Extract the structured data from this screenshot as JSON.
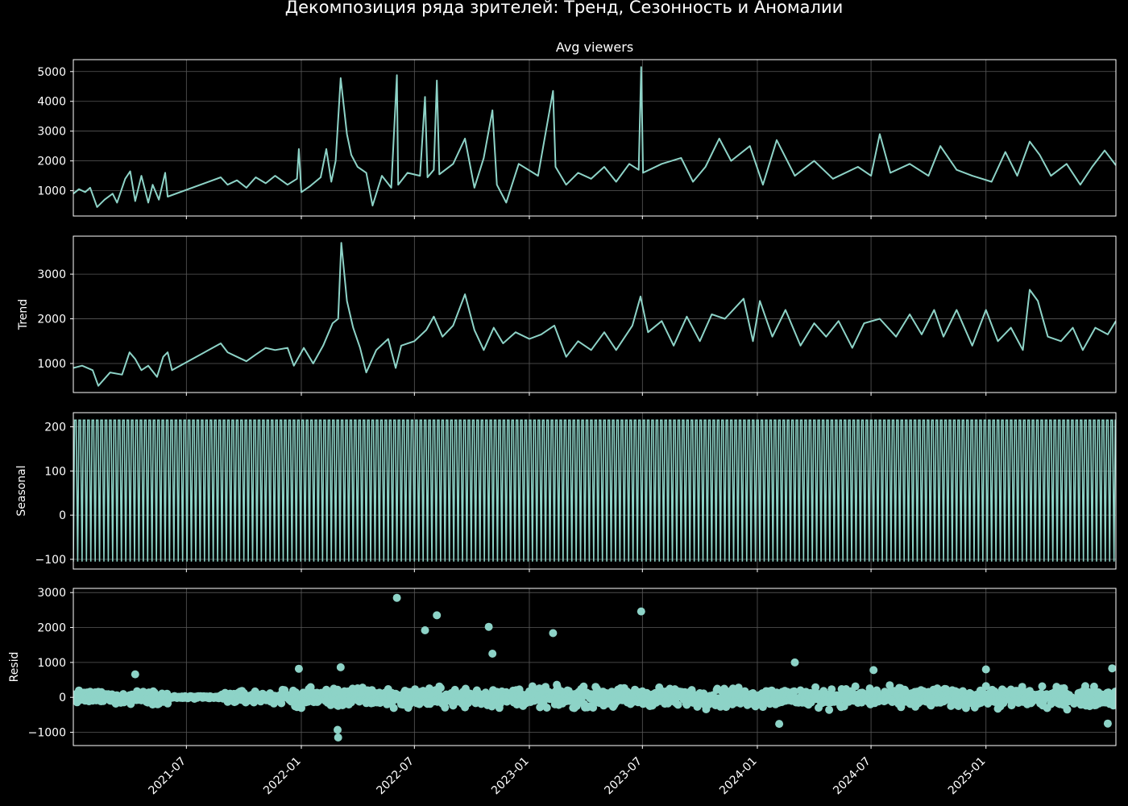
{
  "figure": {
    "title": "Декомпозиция ряда зрителей: Тренд, Сезонность и Аномалии",
    "line_color": "#8dd3c7",
    "background": "#000000"
  },
  "x_axis": {
    "type": "date",
    "range": [
      "2021-01-01",
      "2025-07-28"
    ],
    "tick_values": [
      "2021-07-01",
      "2022-01-01",
      "2022-07-01",
      "2023-01-01",
      "2023-07-01",
      "2024-01-01",
      "2024-07-01",
      "2025-01-01"
    ],
    "tick_labels": [
      "2021-07",
      "2022-01",
      "2022-07",
      "2023-01",
      "2023-07",
      "2024-01",
      "2024-07",
      "2025-01"
    ]
  },
  "chart_data": [
    {
      "type": "line",
      "title": "Avg viewers",
      "ylabel": "",
      "ylim": [
        150,
        5400
      ],
      "yticks": [
        1000,
        2000,
        3000,
        4000,
        5000
      ],
      "grid": true,
      "points": [
        [
          "2021-01-01",
          900
        ],
        [
          "2021-01-10",
          1050
        ],
        [
          "2021-01-20",
          950
        ],
        [
          "2021-01-28",
          1100
        ],
        [
          "2021-02-08",
          450
        ],
        [
          "2021-02-20",
          700
        ],
        [
          "2021-03-05",
          900
        ],
        [
          "2021-03-12",
          600
        ],
        [
          "2021-03-25",
          1400
        ],
        [
          "2021-04-02",
          1650
        ],
        [
          "2021-04-10",
          650
        ],
        [
          "2021-04-20",
          1500
        ],
        [
          "2021-05-01",
          600
        ],
        [
          "2021-05-08",
          1200
        ],
        [
          "2021-05-18",
          700
        ],
        [
          "2021-05-28",
          1600
        ],
        [
          "2021-06-01",
          800
        ],
        [
          "2021-08-25",
          1450
        ],
        [
          "2021-09-05",
          1200
        ],
        [
          "2021-09-20",
          1350
        ],
        [
          "2021-10-05",
          1100
        ],
        [
          "2021-10-20",
          1450
        ],
        [
          "2021-11-05",
          1250
        ],
        [
          "2021-11-20",
          1500
        ],
        [
          "2021-12-10",
          1200
        ],
        [
          "2021-12-25",
          1400
        ],
        [
          "2021-12-28",
          2400
        ],
        [
          "2022-01-01",
          950
        ],
        [
          "2022-01-15",
          1150
        ],
        [
          "2022-02-01",
          1450
        ],
        [
          "2022-02-10",
          2400
        ],
        [
          "2022-02-18",
          1300
        ],
        [
          "2022-02-25",
          2000
        ],
        [
          "2022-03-05",
          4780
        ],
        [
          "2022-03-08",
          4200
        ],
        [
          "2022-03-15",
          2900
        ],
        [
          "2022-03-22",
          2200
        ],
        [
          "2022-04-01",
          1800
        ],
        [
          "2022-04-15",
          1600
        ],
        [
          "2022-04-25",
          500
        ],
        [
          "2022-05-10",
          1500
        ],
        [
          "2022-05-25",
          1100
        ],
        [
          "2022-06-03",
          4880
        ],
        [
          "2022-06-05",
          1200
        ],
        [
          "2022-06-20",
          1600
        ],
        [
          "2022-07-10",
          1500
        ],
        [
          "2022-07-18",
          4150
        ],
        [
          "2022-07-22",
          1450
        ],
        [
          "2022-08-01",
          1700
        ],
        [
          "2022-08-06",
          4700
        ],
        [
          "2022-08-10",
          1550
        ],
        [
          "2022-09-01",
          1900
        ],
        [
          "2022-09-20",
          2750
        ],
        [
          "2022-10-05",
          1100
        ],
        [
          "2022-10-20",
          2100
        ],
        [
          "2022-11-03",
          3700
        ],
        [
          "2022-11-10",
          1200
        ],
        [
          "2022-11-25",
          600
        ],
        [
          "2022-12-15",
          1900
        ],
        [
          "2023-01-15",
          1500
        ],
        [
          "2023-02-08",
          4350
        ],
        [
          "2023-02-12",
          1800
        ],
        [
          "2023-03-01",
          1200
        ],
        [
          "2023-03-20",
          1600
        ],
        [
          "2023-04-10",
          1400
        ],
        [
          "2023-05-01",
          1800
        ],
        [
          "2023-05-20",
          1300
        ],
        [
          "2023-06-10",
          1900
        ],
        [
          "2023-06-25",
          1700
        ],
        [
          "2023-06-29",
          5150
        ],
        [
          "2023-07-02",
          1600
        ],
        [
          "2023-08-01",
          1900
        ],
        [
          "2023-09-01",
          2100
        ],
        [
          "2023-09-20",
          1300
        ],
        [
          "2023-10-10",
          1800
        ],
        [
          "2023-11-01",
          2750
        ],
        [
          "2023-11-20",
          2000
        ],
        [
          "2023-12-20",
          2500
        ],
        [
          "2024-01-10",
          1200
        ],
        [
          "2024-02-01",
          2700
        ],
        [
          "2024-03-01",
          1500
        ],
        [
          "2024-04-01",
          2000
        ],
        [
          "2024-05-01",
          1400
        ],
        [
          "2024-06-10",
          1800
        ],
        [
          "2024-07-01",
          1500
        ],
        [
          "2024-07-15",
          2900
        ],
        [
          "2024-08-01",
          1600
        ],
        [
          "2024-09-01",
          1900
        ],
        [
          "2024-10-01",
          1500
        ],
        [
          "2024-10-20",
          2500
        ],
        [
          "2024-11-15",
          1700
        ],
        [
          "2024-12-10",
          1500
        ],
        [
          "2025-01-10",
          1300
        ],
        [
          "2025-02-01",
          2300
        ],
        [
          "2025-02-20",
          1500
        ],
        [
          "2025-03-12",
          2650
        ],
        [
          "2025-03-28",
          2200
        ],
        [
          "2025-04-15",
          1500
        ],
        [
          "2025-05-10",
          1900
        ],
        [
          "2025-06-01",
          1200
        ],
        [
          "2025-06-20",
          1800
        ],
        [
          "2025-07-10",
          2350
        ],
        [
          "2025-07-28",
          1850
        ]
      ]
    },
    {
      "type": "line",
      "title": "",
      "ylabel": "Trend",
      "ylim": [
        350,
        3850
      ],
      "yticks": [
        1000,
        2000,
        3000
      ],
      "grid": true,
      "points": [
        [
          "2021-01-01",
          900
        ],
        [
          "2021-01-15",
          950
        ],
        [
          "2021-02-01",
          850
        ],
        [
          "2021-02-10",
          500
        ],
        [
          "2021-03-01",
          800
        ],
        [
          "2021-03-20",
          750
        ],
        [
          "2021-04-01",
          1250
        ],
        [
          "2021-04-10",
          1100
        ],
        [
          "2021-04-20",
          850
        ],
        [
          "2021-05-01",
          950
        ],
        [
          "2021-05-15",
          700
        ],
        [
          "2021-05-25",
          1150
        ],
        [
          "2021-06-01",
          1250
        ],
        [
          "2021-06-08",
          850
        ],
        [
          "2021-08-25",
          1450
        ],
        [
          "2021-09-05",
          1250
        ],
        [
          "2021-09-20",
          1150
        ],
        [
          "2021-10-05",
          1050
        ],
        [
          "2021-10-20",
          1200
        ],
        [
          "2021-11-05",
          1350
        ],
        [
          "2021-11-20",
          1300
        ],
        [
          "2021-12-10",
          1350
        ],
        [
          "2021-12-20",
          950
        ],
        [
          "2022-01-05",
          1350
        ],
        [
          "2022-01-20",
          1000
        ],
        [
          "2022-02-05",
          1400
        ],
        [
          "2022-02-20",
          1900
        ],
        [
          "2022-03-01",
          2000
        ],
        [
          "2022-03-06",
          3700
        ],
        [
          "2022-03-15",
          2400
        ],
        [
          "2022-03-25",
          1800
        ],
        [
          "2022-04-05",
          1350
        ],
        [
          "2022-04-15",
          800
        ],
        [
          "2022-05-01",
          1300
        ],
        [
          "2022-05-20",
          1550
        ],
        [
          "2022-06-01",
          900
        ],
        [
          "2022-06-10",
          1400
        ],
        [
          "2022-07-01",
          1500
        ],
        [
          "2022-07-20",
          1750
        ],
        [
          "2022-08-01",
          2050
        ],
        [
          "2022-08-15",
          1600
        ],
        [
          "2022-09-01",
          1850
        ],
        [
          "2022-09-20",
          2550
        ],
        [
          "2022-10-05",
          1750
        ],
        [
          "2022-10-20",
          1300
        ],
        [
          "2022-11-05",
          1800
        ],
        [
          "2022-11-20",
          1450
        ],
        [
          "2022-12-10",
          1700
        ],
        [
          "2023-01-01",
          1550
        ],
        [
          "2023-01-20",
          1650
        ],
        [
          "2023-02-10",
          1850
        ],
        [
          "2023-03-01",
          1150
        ],
        [
          "2023-03-20",
          1500
        ],
        [
          "2023-04-10",
          1300
        ],
        [
          "2023-05-01",
          1700
        ],
        [
          "2023-05-20",
          1300
        ],
        [
          "2023-06-15",
          1850
        ],
        [
          "2023-06-28",
          2500
        ],
        [
          "2023-07-10",
          1700
        ],
        [
          "2023-08-01",
          1950
        ],
        [
          "2023-08-20",
          1400
        ],
        [
          "2023-09-10",
          2050
        ],
        [
          "2023-10-01",
          1500
        ],
        [
          "2023-10-20",
          2100
        ],
        [
          "2023-11-10",
          2000
        ],
        [
          "2023-12-10",
          2450
        ],
        [
          "2023-12-25",
          1500
        ],
        [
          "2024-01-05",
          2400
        ],
        [
          "2024-01-25",
          1600
        ],
        [
          "2024-02-15",
          2200
        ],
        [
          "2024-03-10",
          1400
        ],
        [
          "2024-04-01",
          1900
        ],
        [
          "2024-04-20",
          1600
        ],
        [
          "2024-05-10",
          1950
        ],
        [
          "2024-06-01",
          1350
        ],
        [
          "2024-06-20",
          1900
        ],
        [
          "2024-07-15",
          2000
        ],
        [
          "2024-08-10",
          1600
        ],
        [
          "2024-09-01",
          2100
        ],
        [
          "2024-09-20",
          1650
        ],
        [
          "2024-10-10",
          2200
        ],
        [
          "2024-10-25",
          1600
        ],
        [
          "2024-11-15",
          2200
        ],
        [
          "2024-12-10",
          1400
        ],
        [
          "2025-01-01",
          2200
        ],
        [
          "2025-01-20",
          1500
        ],
        [
          "2025-02-10",
          1800
        ],
        [
          "2025-03-01",
          1300
        ],
        [
          "2025-03-12",
          2650
        ],
        [
          "2025-03-25",
          2400
        ],
        [
          "2025-04-10",
          1600
        ],
        [
          "2025-05-01",
          1500
        ],
        [
          "2025-05-20",
          1800
        ],
        [
          "2025-06-05",
          1300
        ],
        [
          "2025-06-25",
          1800
        ],
        [
          "2025-07-15",
          1650
        ],
        [
          "2025-07-28",
          1950
        ]
      ]
    },
    {
      "type": "line",
      "title": "",
      "ylabel": "Seasonal",
      "ylim": [
        -122,
        232
      ],
      "yticks": [
        -100,
        0,
        100,
        200
      ],
      "grid": true,
      "period_days": 7,
      "amplitude_max": 215,
      "amplitude_min": -105
    },
    {
      "type": "scatter",
      "title": "",
      "ylabel": "Resid",
      "ylim": [
        -1380,
        3120
      ],
      "yticks": [
        -1000,
        0,
        1000,
        2000,
        3000
      ],
      "grid": true,
      "notable_points": [
        [
          "2022-06-03",
          2850
        ],
        [
          "2022-07-18",
          1920
        ],
        [
          "2022-08-06",
          2350
        ],
        [
          "2022-10-28",
          2020
        ],
        [
          "2022-11-03",
          1250
        ],
        [
          "2023-02-08",
          1840
        ],
        [
          "2023-06-29",
          2460
        ],
        [
          "2024-03-01",
          1000
        ],
        [
          "2021-12-28",
          820
        ],
        [
          "2022-03-05",
          860
        ],
        [
          "2021-04-10",
          660
        ],
        [
          "2024-07-05",
          780
        ],
        [
          "2025-01-01",
          800
        ],
        [
          "2025-07-22",
          830
        ],
        [
          "2022-03-01",
          -1150
        ],
        [
          "2022-02-28",
          -930
        ],
        [
          "2024-02-05",
          -760
        ],
        [
          "2025-07-15",
          -750
        ]
      ]
    }
  ]
}
